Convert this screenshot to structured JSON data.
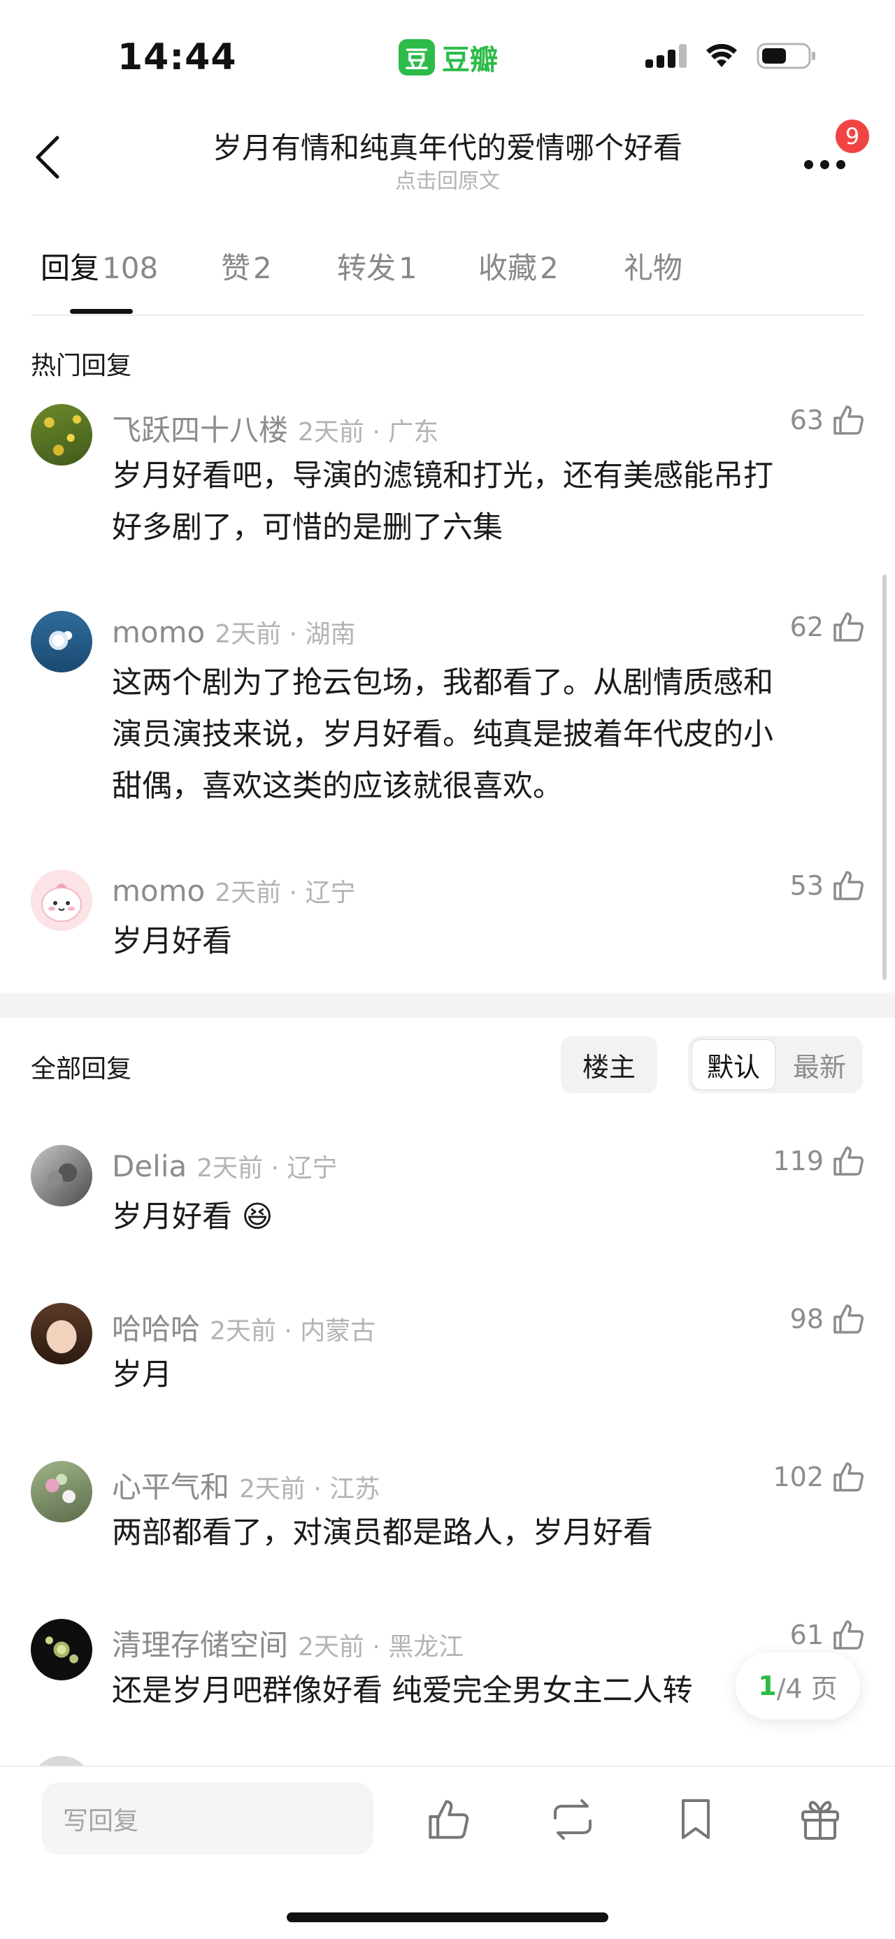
{
  "status_bar": {
    "time": "14:44",
    "app_logo_glyph": "豆",
    "app_name": "豆瓣"
  },
  "header": {
    "title": "岁月有情和纯真年代的爱情哪个好看",
    "subtitle": "点击回原文",
    "notification_count": "9"
  },
  "tabs": [
    {
      "label": "回复",
      "count": "108",
      "active": true
    },
    {
      "label": "赞",
      "count": "2",
      "active": false
    },
    {
      "label": "转发",
      "count": "1",
      "active": false
    },
    {
      "label": "收藏",
      "count": "2",
      "active": false
    },
    {
      "label": "礼物",
      "count": "",
      "active": false
    }
  ],
  "hot_replies": {
    "title": "热门回复",
    "items": [
      {
        "name": "飞跃四十八楼",
        "time": "2天前 · 广东",
        "likes": "63",
        "lines": [
          "岁月好看吧，导演的滤镜和打光，还有美感能吊打",
          "好多剧了，可惜的是删了六集"
        ]
      },
      {
        "name": "momo",
        "time": "2天前 · 湖南",
        "likes": "62",
        "lines": [
          "这两个剧为了抢云包场，我都看了。从剧情质感和",
          "演员演技来说，岁月好看。纯真是披着年代皮的小",
          "甜偶，喜欢这类的应该就很喜欢。"
        ]
      },
      {
        "name": "momo",
        "time": "2天前 · 辽宁",
        "likes": "53",
        "lines": [
          "岁月好看"
        ]
      }
    ]
  },
  "all_replies": {
    "title": "全部回复",
    "filter_op": "楼主",
    "sort_default": "默认",
    "sort_newest": "最新",
    "items": [
      {
        "name": "Delia",
        "time": "2天前 · 辽宁",
        "likes": "119",
        "lines": [
          "岁月好看 😆"
        ]
      },
      {
        "name": "哈哈哈",
        "time": "2天前 · 内蒙古",
        "likes": "98",
        "lines": [
          "岁月"
        ]
      },
      {
        "name": "心平气和",
        "time": "2天前 · 江苏",
        "likes": "102",
        "lines": [
          "两部都看了，对演员都是路人，岁月好看"
        ]
      },
      {
        "name": "清理存储空间",
        "time": "2天前 · 黑龙江",
        "likes": "61",
        "lines": [
          "还是岁月吧群像好看  纯爱完全男女主二人转"
        ]
      }
    ]
  },
  "pagination": {
    "current": "1",
    "rest": "/4 页"
  },
  "bottom_bar": {
    "reply_placeholder": "写回复"
  },
  "colors": {
    "brand_green": "#2dbb4a",
    "badge_red": "#f04444",
    "meta_grey": "#8c8c8c"
  },
  "icons": [
    "back-arrow-icon",
    "more-icon",
    "thumbs-up-icon",
    "repost-icon",
    "bookmark-icon",
    "gift-icon",
    "wifi-icon",
    "battery-icon",
    "signal-icon"
  ]
}
